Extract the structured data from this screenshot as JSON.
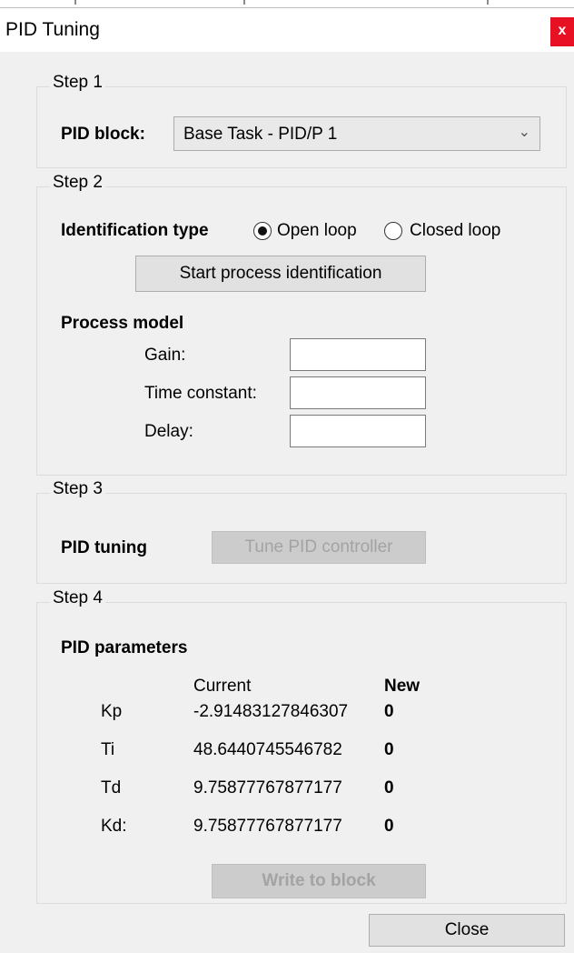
{
  "dialog": {
    "title": "PID Tuning",
    "close_glyph": "x"
  },
  "step1": {
    "label": "Step 1",
    "pid_block_label": "PID block:",
    "pid_block_value": "Base Task - PID/P 1"
  },
  "step2": {
    "label": "Step 2",
    "identification_type_label": "Identification type",
    "open_loop_label": "Open loop",
    "closed_loop_label": "Closed loop",
    "selected": "Open loop",
    "start_button": "Start process identification",
    "process_model_label": "Process model",
    "gain_label": "Gain:",
    "gain_value": "",
    "time_constant_label": "Time constant:",
    "time_constant_value": "",
    "delay_label": "Delay:",
    "delay_value": ""
  },
  "step3": {
    "label": "Step 3",
    "pid_tuning_label": "PID tuning",
    "tune_button": "Tune PID controller"
  },
  "step4": {
    "label": "Step 4",
    "pid_parameters_label": "PID parameters",
    "col_current": "Current",
    "col_new": "New",
    "rows": [
      {
        "name": "Kp",
        "current": "-2.91483127846307",
        "new": "0"
      },
      {
        "name": "Ti",
        "current": "48.6440745546782",
        "new": "0"
      },
      {
        "name": "Td",
        "current": "9.75877767877177",
        "new": "0"
      },
      {
        "name": "Kd:",
        "current": "9.75877767877177",
        "new": "0"
      }
    ],
    "write_button": "Write to block"
  },
  "footer": {
    "close_button": "Close"
  },
  "icons": {
    "dropdown": "chevron-down-icon",
    "close": "close-icon"
  },
  "colors": {
    "close_button_bg": "#e81123",
    "window_bg": "#f0f0f0"
  }
}
